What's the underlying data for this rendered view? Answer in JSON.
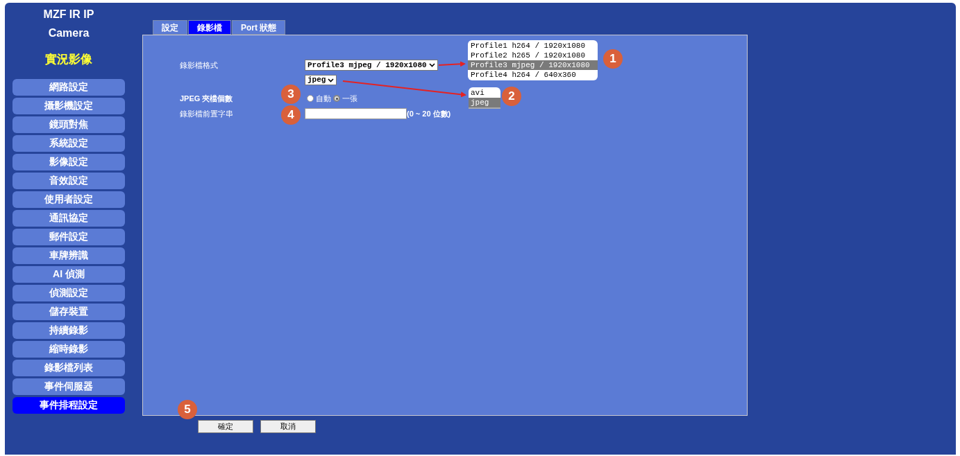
{
  "brand": {
    "title_lines": [
      "MZF IR IP",
      "Camera"
    ],
    "live_view": "實況影像"
  },
  "sidebar": {
    "items": [
      {
        "label": "網路設定",
        "selected": false
      },
      {
        "label": "攝影機設定",
        "selected": false
      },
      {
        "label": "鏡頭對焦",
        "selected": false
      },
      {
        "label": "系統設定",
        "selected": false
      },
      {
        "label": "影像設定",
        "selected": false
      },
      {
        "label": "音效設定",
        "selected": false
      },
      {
        "label": "使用者設定",
        "selected": false
      },
      {
        "label": "通訊協定",
        "selected": false
      },
      {
        "label": "郵件設定",
        "selected": false
      },
      {
        "label": "車牌辨識",
        "selected": false
      },
      {
        "label": "AI 偵測",
        "selected": false
      },
      {
        "label": "偵測設定",
        "selected": false
      },
      {
        "label": "儲存裝置",
        "selected": false
      },
      {
        "label": "持續錄影",
        "selected": false
      },
      {
        "label": "縮時錄影",
        "selected": false
      },
      {
        "label": "錄影檔列表",
        "selected": false
      },
      {
        "label": "事件伺服器",
        "selected": false
      },
      {
        "label": "事件排程設定",
        "selected": true
      }
    ]
  },
  "tabs": [
    {
      "label": "設定",
      "selected": false
    },
    {
      "label": "錄影檔",
      "selected": true
    },
    {
      "label": "Port 狀態",
      "selected": false
    }
  ],
  "form": {
    "format": {
      "label": "錄影檔格式",
      "value": "Profile3 mjpeg / 1920x1080",
      "options": [
        {
          "label": "Profile1 h264 / 1920x1080",
          "selected": false
        },
        {
          "label": "Profile2 h265 / 1920x1080",
          "selected": false
        },
        {
          "label": "Profile3 mjpeg / 1920x1080",
          "selected": true
        },
        {
          "label": "Profile4 h264 / 640x360",
          "selected": false
        }
      ]
    },
    "container": {
      "value": "jpeg",
      "options": [
        {
          "label": "avi",
          "selected": false
        },
        {
          "label": "jpeg",
          "selected": true
        }
      ]
    },
    "jpeg_count": {
      "label": "JPEG 夾檔個數",
      "radios": [
        {
          "label": "自動",
          "selected": false
        },
        {
          "label": "一張",
          "selected": true
        }
      ]
    },
    "prefix": {
      "label": "錄影檔前置字串",
      "hint": "(0 ~ 20 位數)"
    }
  },
  "buttons": [
    "確定",
    "取消"
  ],
  "markers": [
    "1",
    "2",
    "3",
    "4",
    "5"
  ]
}
